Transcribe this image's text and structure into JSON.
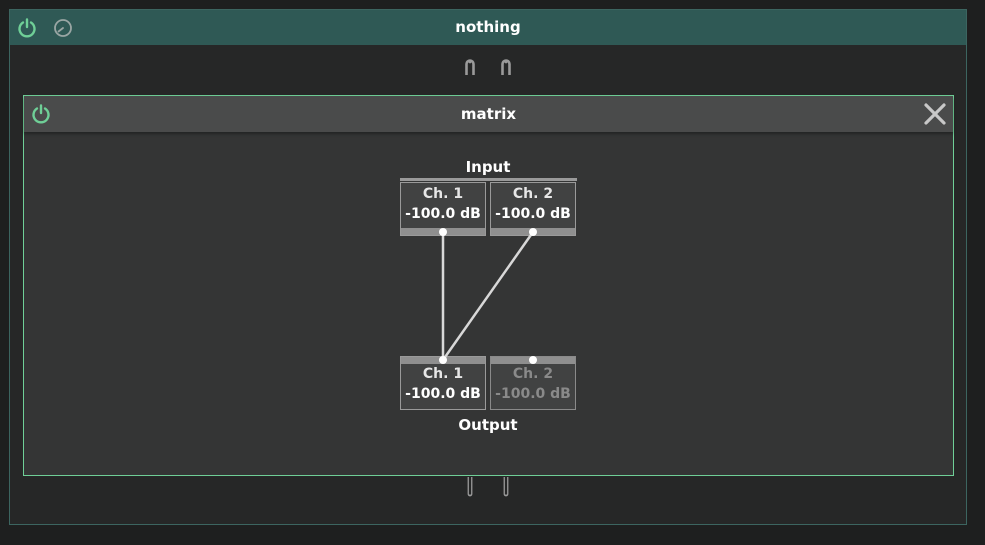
{
  "outer": {
    "title": "nothing",
    "power_color": "#6fcf97"
  },
  "inner": {
    "title": "matrix",
    "power_color": "#6fcf97",
    "border_color": "#6fcf97"
  },
  "matrix": {
    "input_label": "Input",
    "output_label": "Output",
    "inputs": [
      {
        "name": "Ch. 1",
        "level": "-100.0 dB"
      },
      {
        "name": "Ch. 2",
        "level": "-100.0 dB"
      }
    ],
    "outputs": [
      {
        "name": "Ch. 1",
        "level": "-100.0 dB",
        "enabled": true
      },
      {
        "name": "Ch. 2",
        "level": "-100.0 dB",
        "enabled": false
      }
    ],
    "connections": [
      {
        "from": "Ch. 1",
        "to": "Ch. 1"
      },
      {
        "from": "Ch. 2",
        "to": "Ch. 1"
      }
    ]
  }
}
